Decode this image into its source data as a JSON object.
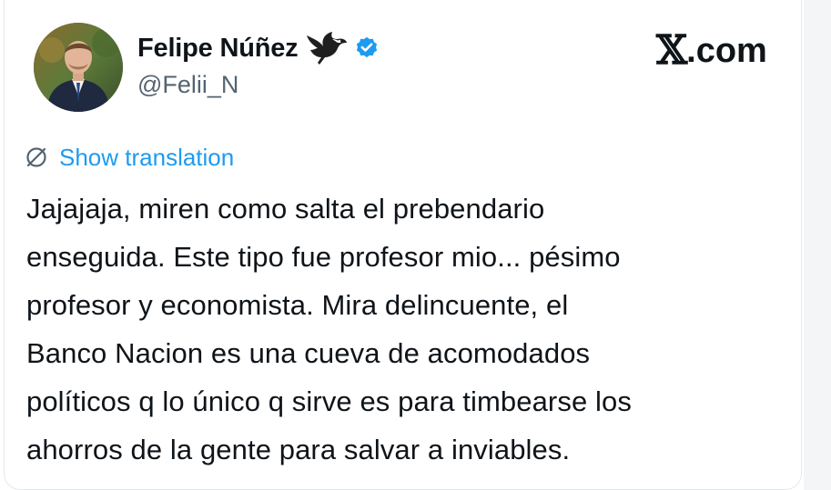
{
  "author": {
    "display_name": "Felipe Núñez",
    "handle": "@Felii_N",
    "badge_icon": "eagle-icon",
    "verified_icon": "verified-badge-icon",
    "verified_color": "#1d9bf0"
  },
  "brand": {
    "x_letter": "𝕏",
    "suffix": ".com"
  },
  "translation": {
    "icon": "translate-globe-icon",
    "label": "Show translation",
    "color": "#1d9bf0"
  },
  "tweet": {
    "lines": [
      "Jajajaja, miren como salta el prebendario",
      "enseguida. Este tipo fue profesor mio... pésimo",
      "profesor y economista. Mira delincuente, el",
      "Banco Nacion es una cueva de acomodados",
      "políticos q lo único q sirve es para timbearse los",
      "ahorros de la gente para salvar a inviables."
    ]
  }
}
